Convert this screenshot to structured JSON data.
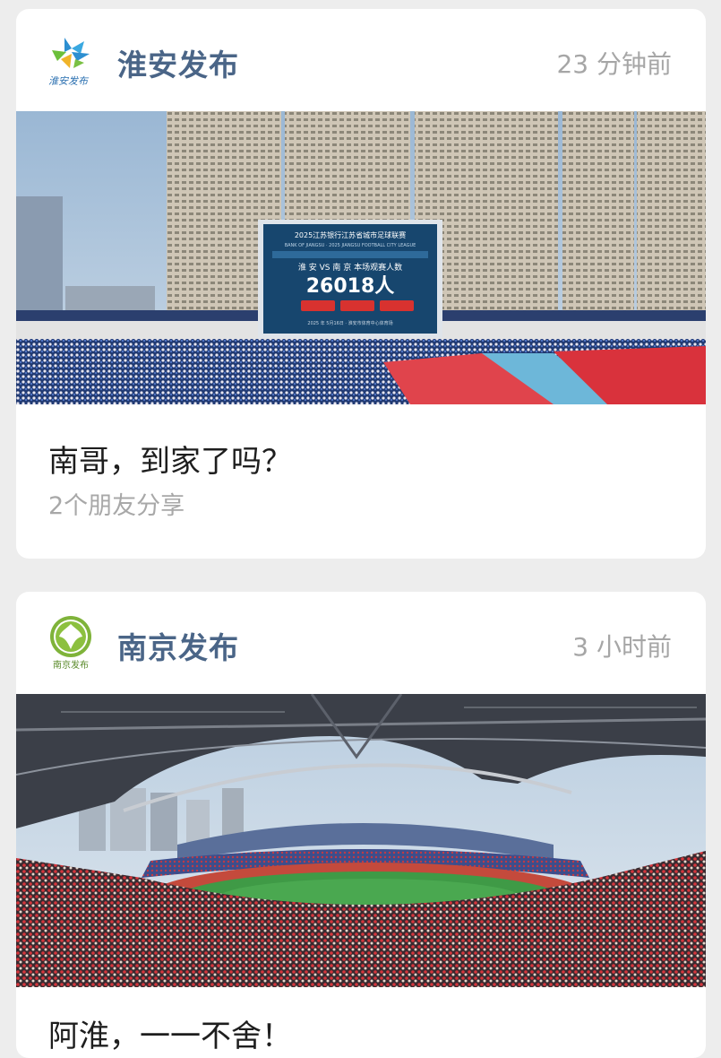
{
  "feed": {
    "articles": [
      {
        "source": "淮安发布",
        "logo_text": "淮安发布",
        "time": "23 分钟前",
        "headline": "南哥，到家了吗？",
        "share_note": "2个朋友分享",
        "photo": {
          "board_title": "2025江苏银行江苏省城市足球联赛",
          "board_subtitle": "BANK OF JIANGSU · 2025 JIANGSU FOOTBALL CITY LEAGUE",
          "board_match": "淮 安  VS  南 京   本场观赛人数",
          "board_count": "26018人",
          "board_date": "2025 年 5月16日 · 淮安市体育中心体育场"
        }
      },
      {
        "source": "南京发布",
        "logo_text": "南京发布",
        "time": "3 小时前",
        "headline": "阿淮，一一不舍！"
      }
    ]
  },
  "colors": {
    "source_name": "#4a6587",
    "time": "#a6a6a6",
    "background": "#ededed",
    "card": "#ffffff",
    "board": "#17466e"
  }
}
